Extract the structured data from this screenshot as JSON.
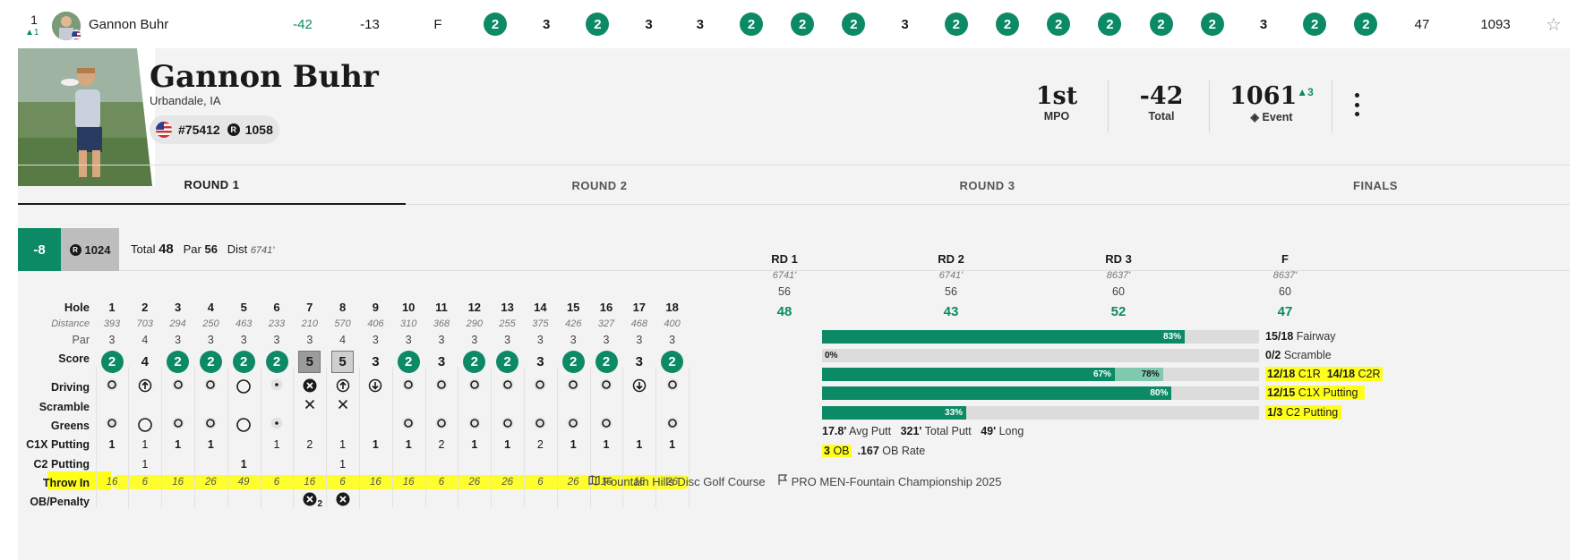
{
  "top_row": {
    "position": "1",
    "position_change": "1",
    "player_name": "Gannon Buhr",
    "total": "-42",
    "round_score": "-13",
    "thru": "F",
    "holes": [
      "2",
      "3",
      "2",
      "3",
      "3",
      "2",
      "2",
      "2",
      "3",
      "2",
      "2",
      "2",
      "2",
      "2",
      "2",
      "3",
      "2",
      "2"
    ],
    "round_total": "47",
    "rating": "1093"
  },
  "player": {
    "name": "Gannon Buhr",
    "location": "Urbandale, IA",
    "pdga_number": "#75412",
    "rating": "1058",
    "place": "1st",
    "place_label": "MPO",
    "total": "-42",
    "total_label": "Total",
    "event_rating": "1061",
    "event_rating_change": "3",
    "event_label": "Event"
  },
  "tabs": [
    "ROUND 1",
    "ROUND 2",
    "ROUND 3",
    "FINALS"
  ],
  "round_summary": {
    "score": "-8",
    "rating": "1024",
    "total_label": "Total",
    "total": "48",
    "par_label": "Par",
    "par": "56",
    "dist_label": "Dist",
    "dist": "6741'"
  },
  "scorecard": {
    "labels": {
      "hole": "Hole",
      "distance": "Distance",
      "par": "Par",
      "score": "Score",
      "driving": "Driving",
      "scramble": "Scramble",
      "greens": "Greens",
      "c1x": "C1X Putting",
      "c2": "C2 Putting",
      "throw_in": "Throw In",
      "ob": "OB/Penalty"
    },
    "holes": [
      "1",
      "2",
      "3",
      "4",
      "5",
      "6",
      "7",
      "8",
      "9",
      "10",
      "11",
      "12",
      "13",
      "14",
      "15",
      "16",
      "17",
      "18"
    ],
    "distance": [
      "393",
      "703",
      "294",
      "250",
      "463",
      "233",
      "210",
      "570",
      "406",
      "310",
      "368",
      "290",
      "255",
      "375",
      "426",
      "327",
      "468",
      "400"
    ],
    "par": [
      "3",
      "4",
      "3",
      "3",
      "3",
      "3",
      "3",
      "4",
      "3",
      "3",
      "3",
      "3",
      "3",
      "3",
      "3",
      "3",
      "3",
      "3"
    ],
    "score": [
      "2",
      "4",
      "2",
      "2",
      "2",
      "2",
      "5",
      "5",
      "3",
      "2",
      "3",
      "2",
      "2",
      "3",
      "2",
      "2",
      "3",
      "2"
    ],
    "score_style": [
      "circle",
      "plain",
      "circle",
      "circle",
      "circle",
      "circle",
      "box-dark",
      "box-light",
      "plain",
      "circle",
      "plain",
      "circle",
      "circle",
      "plain",
      "circle",
      "circle",
      "plain",
      "circle"
    ],
    "driving": [
      "target",
      "up-arrow",
      "target",
      "target",
      "ring",
      "dot",
      "x-circle",
      "up-arrow",
      "down-arrow",
      "target",
      "target",
      "target",
      "target",
      "target",
      "target",
      "target",
      "down-arrow",
      "target"
    ],
    "scramble": [
      "",
      "",
      "",
      "",
      "",
      "",
      "x",
      "x",
      "",
      "",
      "",
      "",
      "",
      "",
      "",
      "",
      "",
      ""
    ],
    "greens": [
      "target",
      "ring",
      "target",
      "target",
      "ring",
      "dot",
      "",
      "",
      "",
      "target",
      "target",
      "target",
      "target",
      "target",
      "target",
      "target",
      "",
      "target"
    ],
    "c1x": [
      "1",
      "1",
      "1",
      "1",
      "",
      "1",
      "2",
      "1",
      "1",
      "1",
      "2",
      "1",
      "1",
      "2",
      "1",
      "1",
      "1",
      "1"
    ],
    "c1x_bold": [
      true,
      false,
      true,
      true,
      false,
      false,
      false,
      false,
      true,
      true,
      false,
      true,
      true,
      false,
      true,
      true,
      true,
      true
    ],
    "c2": [
      "",
      "1",
      "",
      "",
      "1",
      "",
      "",
      "1",
      "",
      "",
      "",
      "",
      "",
      "",
      "",
      "",
      "",
      ""
    ],
    "c2_bold": [
      false,
      false,
      false,
      false,
      true,
      false,
      false,
      false,
      false,
      false,
      false,
      false,
      false,
      false,
      false,
      false,
      false,
      false
    ],
    "throw_in": [
      "16",
      "6",
      "16",
      "26",
      "49",
      "6",
      "16",
      "6",
      "16",
      "16",
      "6",
      "26",
      "26",
      "6",
      "26",
      "16",
      "16",
      "26"
    ],
    "ob": [
      "",
      "",
      "",
      "",
      "",
      "",
      "x2",
      "x",
      "",
      "",
      "",
      "",
      "",
      "",
      "",
      "",
      "",
      ""
    ],
    "ob_count": "2"
  },
  "rounds": [
    {
      "label": "RD 1",
      "dist": "6741'",
      "par": "56",
      "score": "48"
    },
    {
      "label": "RD 2",
      "dist": "6741'",
      "par": "56",
      "score": "43"
    },
    {
      "label": "RD 3",
      "dist": "8637'",
      "par": "60",
      "score": "52"
    },
    {
      "label": "F",
      "dist": "8637'",
      "par": "60",
      "score": "47"
    }
  ],
  "stats": {
    "fairway": {
      "pct": 83,
      "pct_label": "83%",
      "count": "15/18",
      "label": "Fairway"
    },
    "scramble": {
      "pct": 0,
      "pct_label": "0%",
      "count": "0/2",
      "label": "Scramble"
    },
    "greens": {
      "pct": 67,
      "pct_label": "67%",
      "pct2": 78,
      "pct2_label": "78%",
      "c1r": "12/18",
      "c1r_label": "C1R",
      "c2r": "14/18",
      "c2r_label": "C2R"
    },
    "c1x": {
      "pct": 80,
      "pct_label": "80%",
      "count": "12/15",
      "label": "C1X Putting"
    },
    "c2": {
      "pct": 33,
      "pct_label": "33%",
      "count": "1/3",
      "label": "C2 Putting"
    },
    "putting": {
      "avg": "17.8'",
      "avg_label": "Avg Putt",
      "total": "321'",
      "total_label": "Total Putt",
      "long": "49'",
      "long_label": "Long"
    },
    "ob": {
      "count": "3",
      "count_label": "OB",
      "rate": ".167",
      "rate_label": "OB Rate"
    }
  },
  "footer": {
    "course": "Fountain Hills Disc Golf Course",
    "event": "PRO MEN-Fountain Championship 2025"
  },
  "colors": {
    "accent": "#0b8a65",
    "highlight": "#ffff1a",
    "panel": "#f3f3f3"
  }
}
